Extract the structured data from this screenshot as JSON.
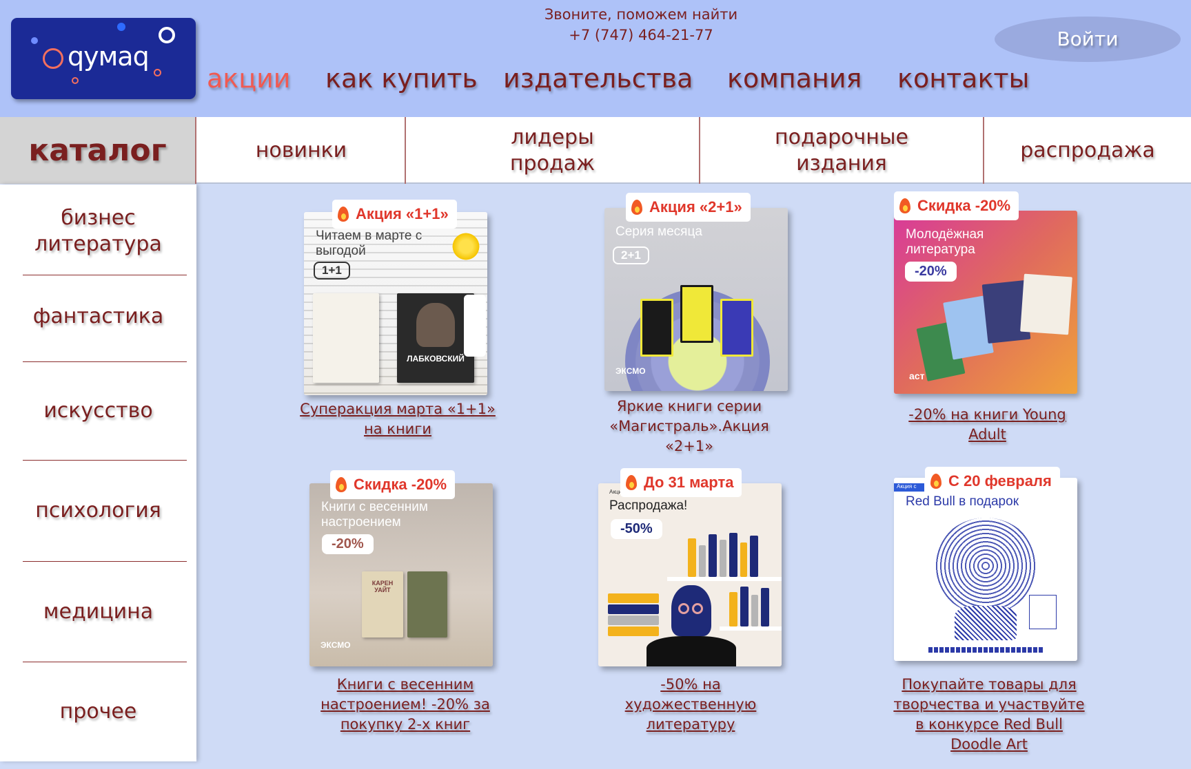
{
  "header": {
    "logo_text": "qумаq",
    "phone_label": "Звоните, поможем найти",
    "phone_number": "+7 (747) 464-21-77",
    "login_label": "Войти",
    "nav": [
      "акции",
      "как купить",
      "издательства",
      "компания",
      "контакты"
    ],
    "active_nav": "акции",
    "accent_color": "#f05a52",
    "text_color": "#7a1f1f",
    "header_bg": "#aec2f8"
  },
  "category_bar": {
    "catalog_label": "каталог",
    "tabs": [
      "новинки",
      "лидеры продаж",
      "подарочные издания",
      "распродажа"
    ]
  },
  "sidebar": {
    "items": [
      "бизнес литература",
      "фантастика",
      "искусство",
      "психология",
      "медицина",
      "прочее"
    ]
  },
  "promos": [
    {
      "badge": "Акция «1+1»",
      "image_title": "Читаем в марте с выгодой",
      "image_tag": "1+1",
      "book_author": "ЛАБКОВСКИЙ",
      "caption": "Суперакция марта «1+1» на книги"
    },
    {
      "badge": "Акция «2+1»",
      "image_title": "Серия месяца",
      "image_tag": "2+1",
      "publisher": "ЭКСМО",
      "caption": "Яркие книги серии «Магистраль».Акция «2+1»"
    },
    {
      "badge": "Скидка -20%",
      "image_title": "Молодёжная литература",
      "image_tag": "-20%",
      "publisher": "аст",
      "caption": "-20% на книги Young Adult"
    },
    {
      "badge": "Скидка -20%",
      "image_title": "Книги с весенним настроением",
      "image_tag": "-20%",
      "book_author": "КАРЕН УАЙТ",
      "publisher": "ЭКСМО",
      "caption": "Книги с весенним настроением! -20% за покупку 2-х книг"
    },
    {
      "badge": "До 31 марта",
      "image_small": "Акция",
      "image_title": "Распродажа!",
      "image_tag": "-50%",
      "caption": "-50% на художественную литературу"
    },
    {
      "badge": "С 20 февраля",
      "image_small": "Акция с",
      "image_title": "Red Bull в подарок",
      "caption": "Покупайте товары для творчества и участвуйте в конкурсе Red Bull Doodle Art"
    }
  ]
}
